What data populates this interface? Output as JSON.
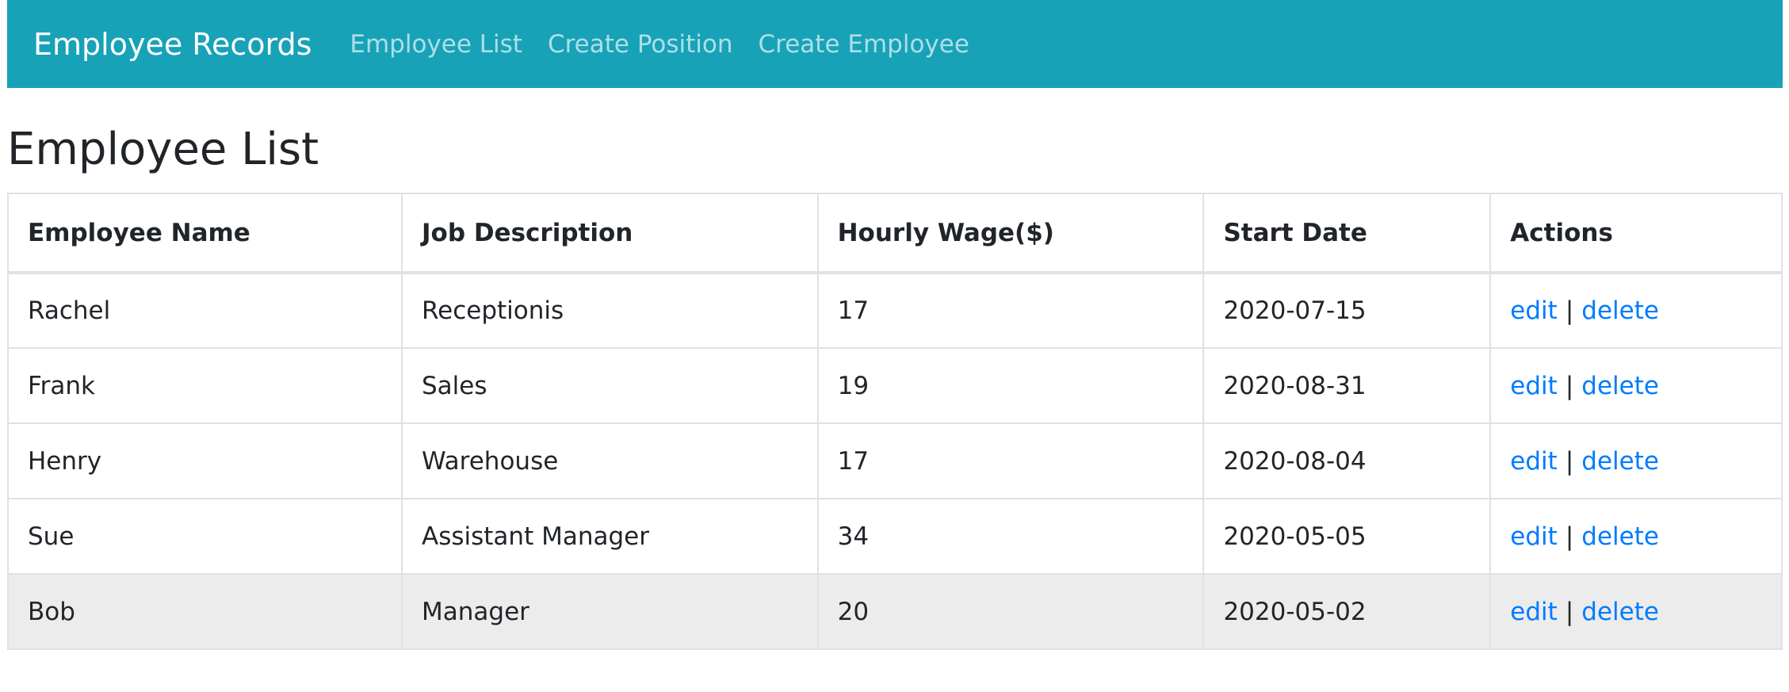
{
  "navbar": {
    "brand": "Employee Records",
    "links": [
      "Employee List",
      "Create Position",
      "Create Employee"
    ]
  },
  "page": {
    "title": "Employee List"
  },
  "table": {
    "headers": [
      "Employee Name",
      "Job Description",
      "Hourly Wage($)",
      "Start Date",
      "Actions"
    ],
    "rows": [
      {
        "name": "Rachel",
        "job": "Receptionis",
        "wage": "17",
        "start": "2020-07-15"
      },
      {
        "name": "Frank",
        "job": "Sales",
        "wage": "19",
        "start": "2020-08-31"
      },
      {
        "name": "Henry",
        "job": "Warehouse",
        "wage": "17",
        "start": "2020-08-04"
      },
      {
        "name": "Sue",
        "job": "Assistant Manager",
        "wage": "34",
        "start": "2020-05-05"
      },
      {
        "name": "Bob",
        "job": "Manager",
        "wage": "20",
        "start": "2020-05-02"
      }
    ],
    "actions": {
      "edit": "edit",
      "separator": "|",
      "delete": "delete"
    }
  },
  "colors": {
    "navbar_bg": "#17a2b8",
    "link": "#007bff",
    "hover_row": "#ececec"
  }
}
